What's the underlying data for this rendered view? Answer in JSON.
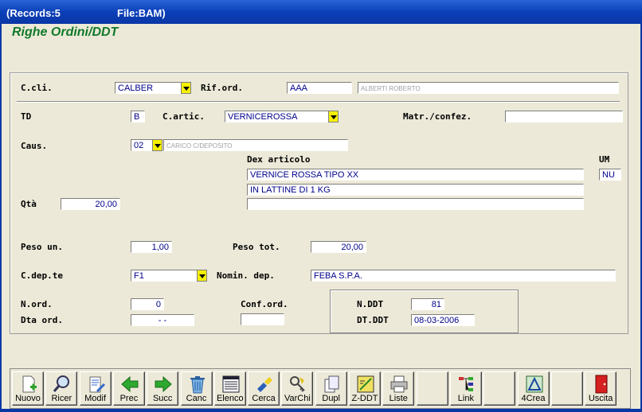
{
  "titlebar": {
    "records": "(Records:5",
    "file": "File:BAM)"
  },
  "heading": "Righe Ordini/DDT",
  "fields": {
    "ccli_label": "C.cli.",
    "ccli_value": "CALBER",
    "riford_label": "Rif.ord.",
    "riford_value": "AAA",
    "riford_desc": "ALBERTI ROBERTO",
    "td_label": "TD",
    "td_value": "B",
    "cartic_label": "C.artic.",
    "cartic_value": "VERNICEROSSA",
    "matr_label": "Matr./confez.",
    "matr_value": "",
    "caus_label": "Caus.",
    "caus_value": "02",
    "caus_desc": "CARICO C/DEPOSITO",
    "dex_label": "Dex articolo",
    "dex_line1": "VERNICE ROSSA TIPO XX",
    "dex_line2": "IN LATTINE DI 1 KG",
    "dex_line3": "",
    "um_label": "UM",
    "um_value": "NU",
    "qta_label": "Qtà",
    "qta_value": "20,00",
    "pesoun_label": "Peso un.",
    "pesoun_value": "1,00",
    "pesotot_label": "Peso tot.",
    "pesotot_value": "20,00",
    "cdep_label": "C.dep.te",
    "cdep_value": "F1",
    "nomdep_label": "Nomin. dep.",
    "nomdep_value": "FEBA S.P.A.",
    "nord_label": "N.ord.",
    "nord_value": "0",
    "conford_label": "Conf.ord.",
    "conford_value": "",
    "dtaord_label": "Dta ord.",
    "dtaord_value": "-   -",
    "nddt_label": "N.DDT",
    "nddt_value": "81",
    "dtddt_label": "DT.DDT",
    "dtddt_value": "08-03-2006"
  },
  "toolbar": [
    {
      "label": "Nuovo",
      "icon": "new-document-icon"
    },
    {
      "label": "Ricer",
      "icon": "search-icon"
    },
    {
      "label": "Modif",
      "icon": "edit-icon"
    },
    {
      "label": "Prec",
      "icon": "arrow-left-icon"
    },
    {
      "label": "Succ",
      "icon": "arrow-right-icon"
    },
    {
      "label": "Canc",
      "icon": "trash-icon"
    },
    {
      "label": "Elenco",
      "icon": "list-icon"
    },
    {
      "label": "Cerca",
      "icon": "search-flashlight-icon"
    },
    {
      "label": "VarChi",
      "icon": "keys-icon"
    },
    {
      "label": "Dupl",
      "icon": "duplicate-icon"
    },
    {
      "label": "Z-DDT",
      "icon": "ddt-icon"
    },
    {
      "label": "Liste",
      "icon": "printer-icon"
    },
    {
      "label": "",
      "icon": ""
    },
    {
      "label": "Link",
      "icon": "link-tree-icon"
    },
    {
      "label": "",
      "icon": ""
    },
    {
      "label": "4Crea",
      "icon": "create-icon"
    },
    {
      "label": "",
      "icon": ""
    },
    {
      "label": "Uscita",
      "icon": "exit-door-icon"
    }
  ],
  "colors": {
    "accent_heading": "#117a2a",
    "field_text": "#00008b",
    "dropdown": "#f5f000",
    "titlebar": "#0b3fb8"
  }
}
